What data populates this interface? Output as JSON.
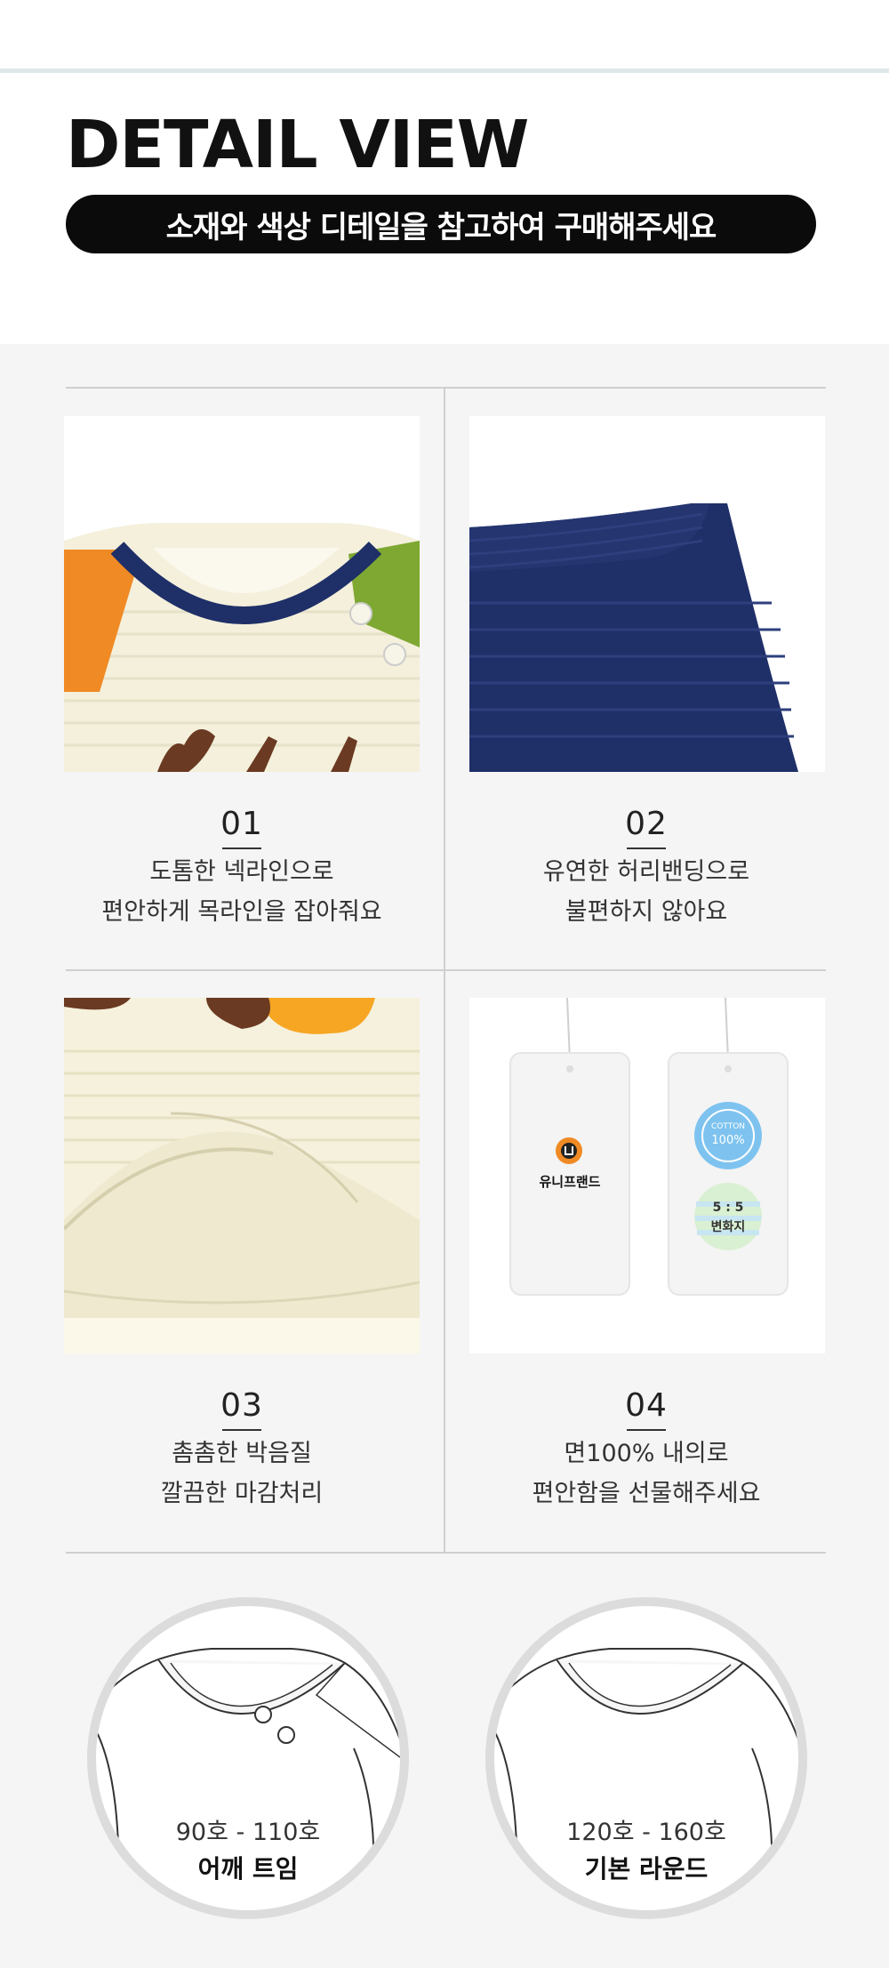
{
  "header": {
    "title": "DETAIL VIEW",
    "subtitle": "소재와 색상 디테일을 참고하여 구매해주세요"
  },
  "details": [
    {
      "num": "01",
      "line1": "도톰한 넥라인으로",
      "line2": "편안하게 목라인을 잡아줘요"
    },
    {
      "num": "02",
      "line1": "유연한 허리밴딩으로",
      "line2": "불편하지 않아요"
    },
    {
      "num": "03",
      "line1": "촘촘한 박음질",
      "line2": "깔끔한 마감처리"
    },
    {
      "num": "04",
      "line1": "면100% 내의로",
      "line2": "편안함을 선물해주세요"
    }
  ],
  "tags": {
    "brand": "유니프랜드",
    "cotton_top": "COTTON",
    "cotton_pct": "100%",
    "ratio": "5 : 5",
    "ratio_label": "변화지"
  },
  "necklines": [
    {
      "size": "90호 - 110호",
      "type": "어깨 트임"
    },
    {
      "size": "120호 - 160호",
      "type": "기본 라운드"
    }
  ],
  "colors": {
    "navy": "#1f2f68",
    "orange": "#f08a24",
    "green": "#7fa832",
    "cream": "#f4f0dc"
  }
}
